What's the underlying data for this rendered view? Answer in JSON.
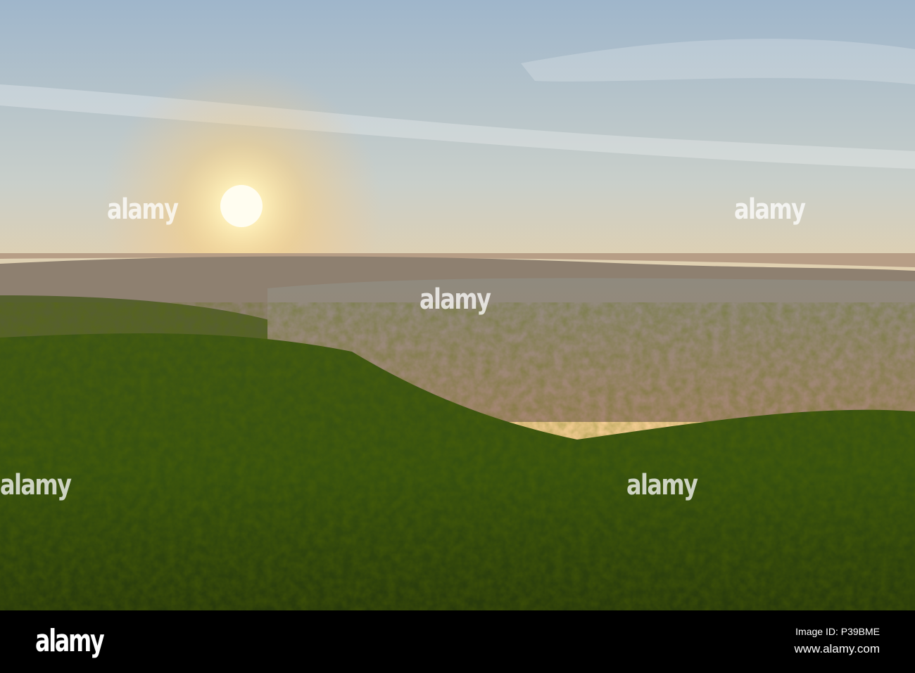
{
  "watermark": {
    "text": "alamy"
  },
  "footer": {
    "logo": "alamy",
    "image_id": "Image ID: P39BME",
    "url": "www.alamy.com"
  },
  "colors": {
    "sky_top": "#a8bccc",
    "horizon": "#f7c88c",
    "sun": "#fff6d8",
    "forest": "#2f4a12",
    "city": "#9a8a7c"
  }
}
